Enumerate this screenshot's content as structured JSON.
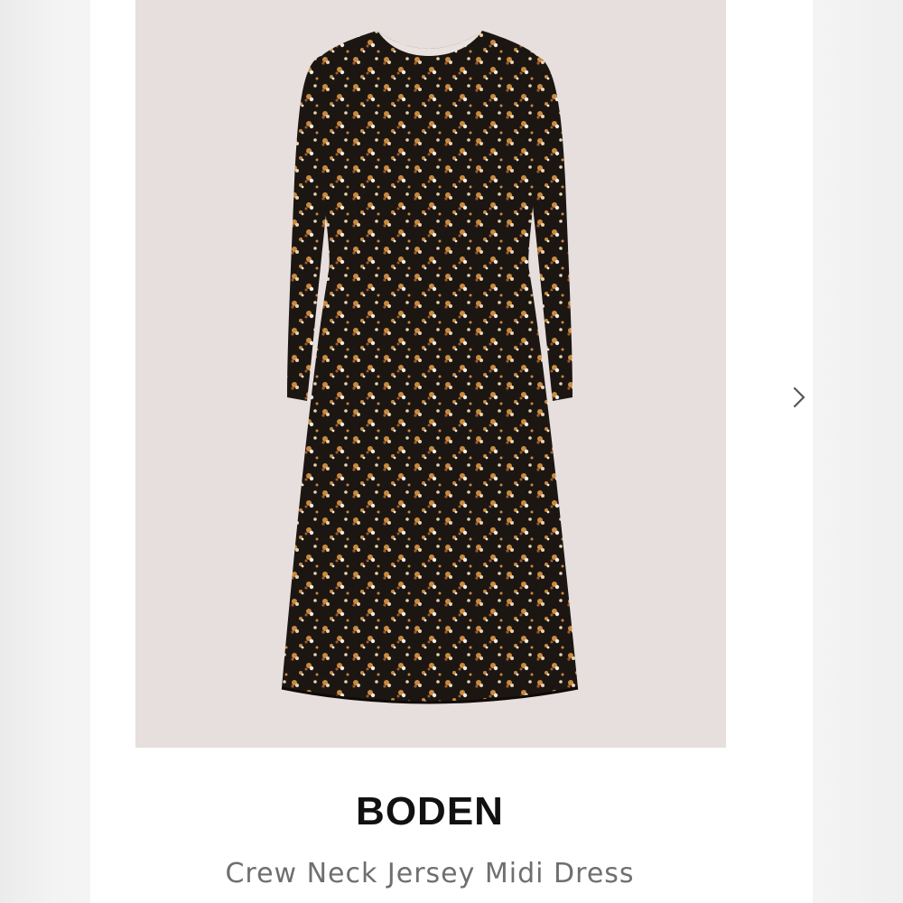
{
  "product": {
    "brand": "BODEN",
    "name": "Crew Neck Jersey Midi Dress",
    "image_alt": "Black floral print long-sleeve midi dress",
    "image_background": "#e6dfdd",
    "dress_color": "#1c1613",
    "print_colors": [
      "#c98a3e",
      "#e7d3b0",
      "#a05a2c",
      "#f1ede4"
    ]
  },
  "carousel": {
    "next_icon": "chevron-right-icon"
  }
}
